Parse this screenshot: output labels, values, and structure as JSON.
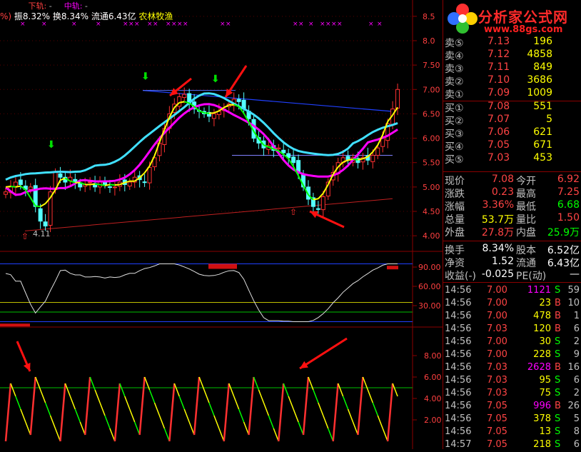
{
  "header": {
    "prefix_line1": "",
    "lower_rail": "下轨:",
    "lower_rail_val": "-",
    "middle_rail": "中轨:",
    "middle_rail_val": "-",
    "paren": "%)",
    "amplitude": "振8.32%",
    "turnover": "换8.34%",
    "float_cap": "流通6.43亿",
    "sector": "农林牧渔"
  },
  "colors": {
    "up": "#ff3030",
    "down": "#54ffff",
    "yellow": "#ffff00",
    "magenta": "#ff00ff",
    "cyan": "#40e0ff",
    "green": "#00ff00",
    "axis_red": "#8b0000"
  },
  "logo": {
    "title": "分析家公式网",
    "url": "www.88gs.com",
    "icon": "flower-logo-icon"
  },
  "chart_data": [
    {
      "type": "candlestick",
      "name": "main",
      "y_axis_ticks": [
        "8.5",
        "8.0",
        "7.50",
        "7.00",
        "6.50",
        "6.00",
        "5.50",
        "5.00",
        "4.50",
        "4.00"
      ],
      "ylim": [
        3.9,
        8.6
      ],
      "annotations": [
        "4.11"
      ],
      "closes": [
        4.9,
        5.0,
        5.1,
        5.05,
        4.95,
        5.0,
        4.6,
        4.3,
        4.2,
        4.9,
        5.3,
        5.2,
        5.1,
        5.2,
        5.1,
        5.0,
        5.05,
        5.1,
        5.0,
        5.1,
        5.05,
        5.0,
        5.0,
        5.1,
        5.05,
        5.1,
        5.2,
        5.15,
        5.1,
        5.4,
        5.6,
        5.9,
        6.2,
        6.5,
        6.7,
        6.85,
        6.9,
        6.7,
        6.6,
        6.55,
        6.5,
        6.45,
        6.5,
        6.55,
        6.6,
        6.7,
        6.8,
        6.75,
        6.6,
        6.4,
        6.0,
        5.9,
        5.8,
        5.85,
        5.75,
        5.8,
        5.7,
        5.6,
        5.5,
        5.3,
        5.0,
        4.75,
        4.6,
        4.55,
        4.8,
        5.1,
        5.3,
        5.5,
        5.6,
        5.55,
        5.6,
        5.5,
        5.6,
        5.55,
        5.65,
        5.8,
        6.0,
        6.3,
        6.6,
        7.0
      ]
    },
    {
      "type": "line",
      "name": "indicator1",
      "y_axis_ticks": [
        "90.00",
        "60.00",
        "30.00"
      ],
      "ylim": [
        0,
        100
      ]
    },
    {
      "type": "line",
      "name": "indicator2",
      "y_axis_ticks": [
        "8.00",
        "6.00",
        "4.00",
        "2.00"
      ],
      "ylim": [
        0,
        10
      ]
    }
  ],
  "order_book": {
    "asks": [
      {
        "label": "卖⑤",
        "price": "7.13",
        "vol": "196"
      },
      {
        "label": "卖④",
        "price": "7.12",
        "vol": "4858"
      },
      {
        "label": "卖③",
        "price": "7.11",
        "vol": "849"
      },
      {
        "label": "卖②",
        "price": "7.10",
        "vol": "3686"
      },
      {
        "label": "卖①",
        "price": "7.09",
        "vol": "1009"
      }
    ],
    "bids": [
      {
        "label": "买①",
        "price": "7.08",
        "vol": "551"
      },
      {
        "label": "买②",
        "price": "7.07",
        "vol": "5"
      },
      {
        "label": "买③",
        "price": "7.06",
        "vol": "621"
      },
      {
        "label": "买④",
        "price": "7.05",
        "vol": "671"
      },
      {
        "label": "买⑤",
        "price": "7.03",
        "vol": "453"
      }
    ]
  },
  "quote": {
    "rows": [
      {
        "l1": "现价",
        "v1": "7.08",
        "c1": "#ff4444",
        "l2": "今开",
        "v2": "6.92",
        "c2": "#ff4444"
      },
      {
        "l1": "涨跌",
        "v1": "0.23",
        "c1": "#ff4444",
        "l2": "最高",
        "v2": "7.25",
        "c2": "#ff4444"
      },
      {
        "l1": "涨幅",
        "v1": "3.36%",
        "c1": "#ff4444",
        "l2": "最低",
        "v2": "6.68",
        "c2": "#00ff00"
      },
      {
        "l1": "总量",
        "v1": "53.7万",
        "c1": "#ffff00",
        "l2": "量比",
        "v2": "1.50",
        "c2": "#ff4444"
      },
      {
        "l1": "外盘",
        "v1": "27.8万",
        "c1": "#ff4444",
        "l2": "内盘",
        "v2": "25.9万",
        "c2": "#00ff00"
      }
    ],
    "rows2": [
      {
        "l1": "换手",
        "v1": "8.34%",
        "c1": "#ffffff",
        "l2": "股本",
        "v2": "6.52亿",
        "c2": "#ffffff"
      },
      {
        "l1": "净资",
        "v1": "1.52",
        "c1": "#ffffff",
        "l2": "流通",
        "v2": "6.43亿",
        "c2": "#ffffff"
      },
      {
        "l1": "收益(-)",
        "v1": "-0.025",
        "c1": "#ffffff",
        "l2": "PE(动)",
        "v2": "—",
        "c2": "#ffffff"
      }
    ]
  },
  "ticks": [
    {
      "t": "14:56",
      "p": "7.00",
      "pc": "#ff4444",
      "v": "1121",
      "vc": "#ff00ff",
      "s": "S",
      "sc": "#00ff00",
      "n": "59"
    },
    {
      "t": "14:56",
      "p": "7.00",
      "pc": "#ff4444",
      "v": "23",
      "vc": "#ffff00",
      "s": "B",
      "sc": "#ff4444",
      "n": "10"
    },
    {
      "t": "14:56",
      "p": "7.00",
      "pc": "#ff4444",
      "v": "478",
      "vc": "#ffff00",
      "s": "B",
      "sc": "#ff4444",
      "n": "1"
    },
    {
      "t": "14:56",
      "p": "7.03",
      "pc": "#ff4444",
      "v": "120",
      "vc": "#ffff00",
      "s": "B",
      "sc": "#ff4444",
      "n": "6"
    },
    {
      "t": "14:56",
      "p": "7.00",
      "pc": "#ff4444",
      "v": "30",
      "vc": "#ffff00",
      "s": "S",
      "sc": "#00ff00",
      "n": "2"
    },
    {
      "t": "14:56",
      "p": "7.00",
      "pc": "#ff4444",
      "v": "228",
      "vc": "#ffff00",
      "s": "S",
      "sc": "#00ff00",
      "n": "9"
    },
    {
      "t": "14:56",
      "p": "7.03",
      "pc": "#ff4444",
      "v": "2628",
      "vc": "#ff00ff",
      "s": "B",
      "sc": "#ff4444",
      "n": "16"
    },
    {
      "t": "14:56",
      "p": "7.03",
      "pc": "#ff4444",
      "v": "95",
      "vc": "#ffff00",
      "s": "S",
      "sc": "#00ff00",
      "n": "6"
    },
    {
      "t": "14:56",
      "p": "7.03",
      "pc": "#ff4444",
      "v": "75",
      "vc": "#ffff00",
      "s": "S",
      "sc": "#00ff00",
      "n": "2"
    },
    {
      "t": "14:56",
      "p": "7.05",
      "pc": "#ff4444",
      "v": "996",
      "vc": "#ff00ff",
      "s": "B",
      "sc": "#ff4444",
      "n": "26"
    },
    {
      "t": "14:56",
      "p": "7.05",
      "pc": "#ff4444",
      "v": "378",
      "vc": "#ffff00",
      "s": "S",
      "sc": "#00ff00",
      "n": "5"
    },
    {
      "t": "14:56",
      "p": "7.05",
      "pc": "#ff4444",
      "v": "13",
      "vc": "#ffff00",
      "s": "S",
      "sc": "#00ff00",
      "n": "8"
    },
    {
      "t": "14:57",
      "p": "7.05",
      "pc": "#ff4444",
      "v": "218",
      "vc": "#ffff00",
      "s": "S",
      "sc": "#00ff00",
      "n": "6"
    }
  ]
}
